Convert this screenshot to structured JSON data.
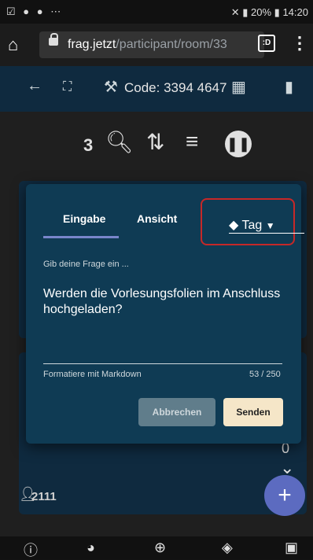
{
  "status": {
    "left_icons": "☑ ● ● ⋯",
    "battery": "20%",
    "time": "14:20"
  },
  "browser": {
    "url_host": "frag.jetzt",
    "url_path": "/participant/room/33",
    "tab_count_label": ":D"
  },
  "toolbar": {
    "code_label": "Code: 3394 4647"
  },
  "controls": {
    "count": "3"
  },
  "background_card": {
    "user_count": "2111"
  },
  "dialog": {
    "tabs": [
      {
        "label": "Eingabe"
      },
      {
        "label": "Ansicht"
      }
    ],
    "tag_label": "Tag",
    "prompt": "Gib deine Frage ein ...",
    "question": "Werden die Vorlesungsfolien im Anschluss hochgeladen?",
    "markdown_hint": "Formatiere mit Markdown",
    "char_counter": "53 / 250",
    "cancel_label": "Abbrechen",
    "send_label": "Senden"
  },
  "colors": {
    "toolbar_bg": "#0f2a3f",
    "dialog_bg": "#0f3b54",
    "highlight_border": "#c62828",
    "send_button": "#f5e6c8",
    "cancel_button": "#607d8b",
    "fab": "#5c6bc0"
  }
}
